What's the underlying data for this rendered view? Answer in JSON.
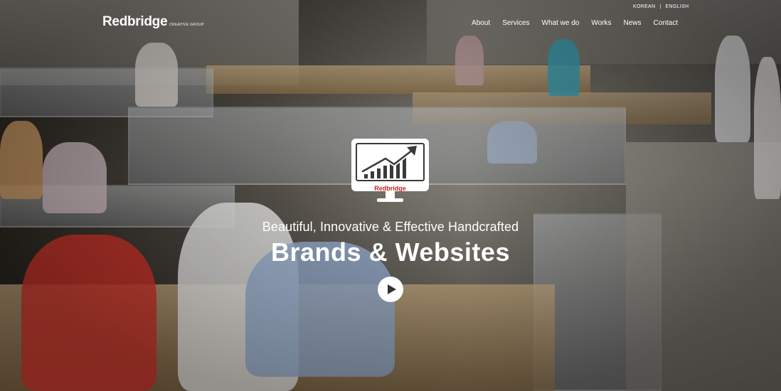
{
  "header": {
    "logo_text": "Redbridge",
    "logo_subtext": "CREATIVE GROUP",
    "languages": [
      "KOREAN",
      "ENGLISH"
    ],
    "language_separator": "|",
    "nav": [
      "About",
      "Services",
      "What we do",
      "Works",
      "News",
      "Contact"
    ]
  },
  "hero": {
    "icon_label": "Redbridge",
    "tagline": "Beautiful, Innovative & Effective Handcrafted",
    "headline": "Brands & Websites",
    "play_icon": "play-icon",
    "accent_color": "#cc1f1f"
  }
}
